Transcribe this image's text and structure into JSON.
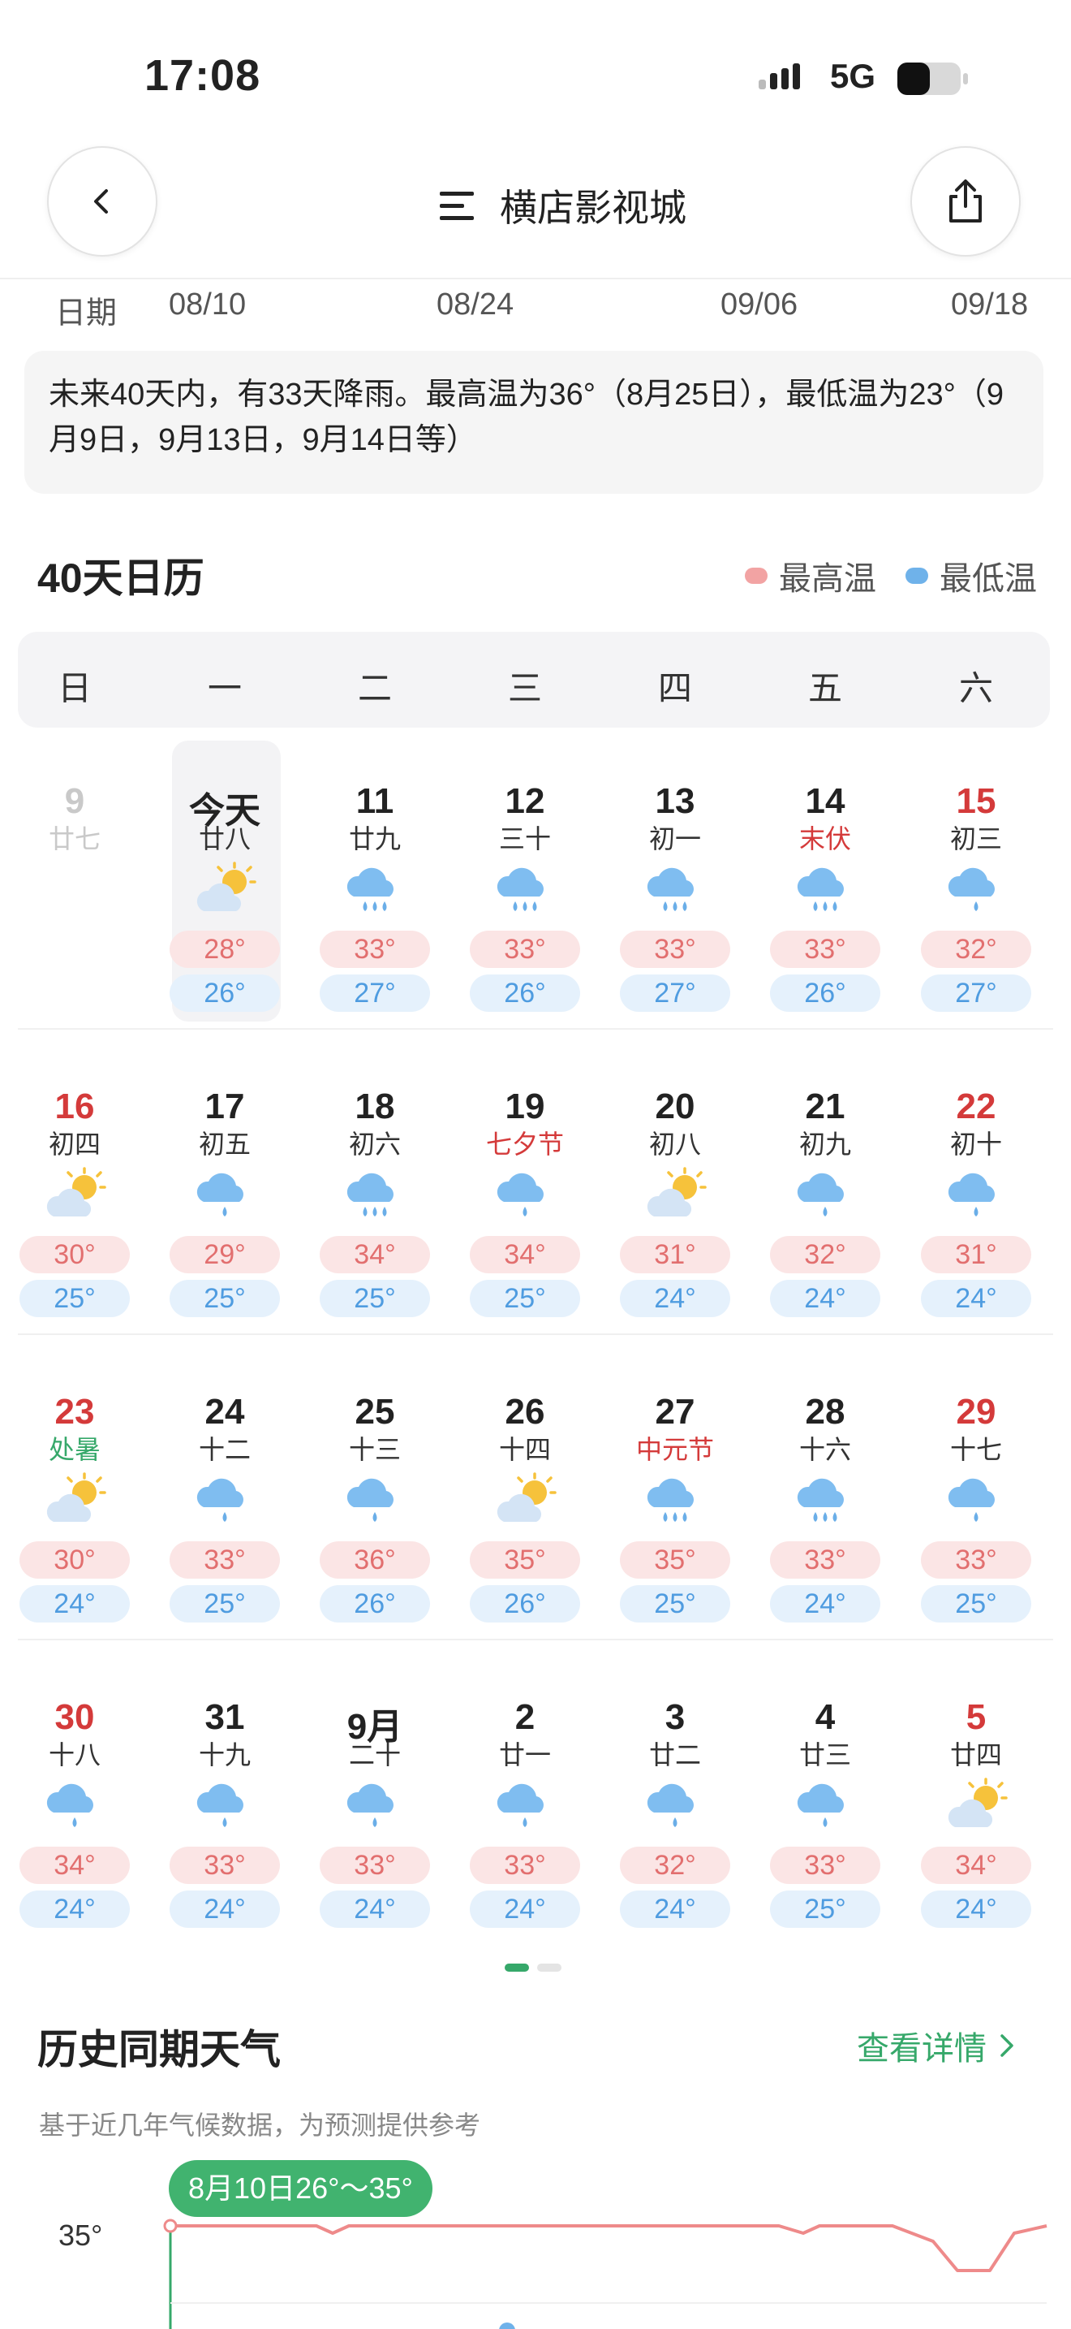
{
  "status": {
    "time": "17:08",
    "network": "5G"
  },
  "header": {
    "title": "横店影视城"
  },
  "axis": {
    "label": "日期",
    "dates": [
      "08/10",
      "08/24",
      "09/06",
      "09/18"
    ]
  },
  "summary": {
    "text": "未来40天内，有33天降雨。最高温为36°（8月25日），最低温为23°（9月9日，9月13日，9月14日等）"
  },
  "calendar": {
    "title": "40天日历",
    "legend": {
      "high": "最高温",
      "low": "最低温",
      "high_color": "#f2a3a3",
      "low_color": "#6fb2ea"
    },
    "weekdays": [
      "日",
      "一",
      "二",
      "三",
      "四",
      "五",
      "六"
    ],
    "rows": [
      [
        {
          "d": "9",
          "l": "廿七",
          "icon": "",
          "hi": "",
          "lo": "",
          "state": "past"
        },
        {
          "d": "今天",
          "l": "廿八",
          "icon": "sun-cloud",
          "hi": "28°",
          "lo": "26°",
          "state": "today"
        },
        {
          "d": "11",
          "l": "廿九",
          "icon": "rain-heavy",
          "hi": "33°",
          "lo": "27°"
        },
        {
          "d": "12",
          "l": "三十",
          "icon": "rain-heavy",
          "hi": "33°",
          "lo": "26°"
        },
        {
          "d": "13",
          "l": "初一",
          "icon": "rain-heavy",
          "hi": "33°",
          "lo": "27°"
        },
        {
          "d": "14",
          "l": "末伏",
          "icon": "rain-heavy",
          "hi": "33°",
          "lo": "26°",
          "lunar": "red"
        },
        {
          "d": "15",
          "l": "初三",
          "icon": "rain-light",
          "hi": "32°",
          "lo": "27°",
          "day": "red"
        }
      ],
      [
        {
          "d": "16",
          "l": "初四",
          "icon": "sun-cloud",
          "hi": "30°",
          "lo": "25°",
          "day": "red"
        },
        {
          "d": "17",
          "l": "初五",
          "icon": "rain-light",
          "hi": "29°",
          "lo": "25°"
        },
        {
          "d": "18",
          "l": "初六",
          "icon": "rain-heavy",
          "hi": "34°",
          "lo": "25°"
        },
        {
          "d": "19",
          "l": "七夕节",
          "icon": "rain-light",
          "hi": "34°",
          "lo": "25°",
          "lunar": "red"
        },
        {
          "d": "20",
          "l": "初八",
          "icon": "sun-cloud",
          "hi": "31°",
          "lo": "24°"
        },
        {
          "d": "21",
          "l": "初九",
          "icon": "rain-light",
          "hi": "32°",
          "lo": "24°"
        },
        {
          "d": "22",
          "l": "初十",
          "icon": "rain-light",
          "hi": "31°",
          "lo": "24°",
          "day": "red"
        }
      ],
      [
        {
          "d": "23",
          "l": "处暑",
          "icon": "sun-cloud",
          "hi": "30°",
          "lo": "24°",
          "day": "red",
          "lunar": "green"
        },
        {
          "d": "24",
          "l": "十二",
          "icon": "rain-light",
          "hi": "33°",
          "lo": "25°"
        },
        {
          "d": "25",
          "l": "十三",
          "icon": "rain-light",
          "hi": "36°",
          "lo": "26°"
        },
        {
          "d": "26",
          "l": "十四",
          "icon": "sun-cloud",
          "hi": "35°",
          "lo": "26°"
        },
        {
          "d": "27",
          "l": "中元节",
          "icon": "rain-heavy",
          "hi": "35°",
          "lo": "25°",
          "lunar": "red"
        },
        {
          "d": "28",
          "l": "十六",
          "icon": "rain-heavy",
          "hi": "33°",
          "lo": "24°"
        },
        {
          "d": "29",
          "l": "十七",
          "icon": "rain-light",
          "hi": "33°",
          "lo": "25°",
          "day": "red"
        }
      ],
      [
        {
          "d": "30",
          "l": "十八",
          "icon": "rain-light",
          "hi": "34°",
          "lo": "24°",
          "day": "red"
        },
        {
          "d": "31",
          "l": "十九",
          "icon": "rain-light",
          "hi": "33°",
          "lo": "24°"
        },
        {
          "d": "9月",
          "l": "二十",
          "icon": "rain-light",
          "hi": "33°",
          "lo": "24°"
        },
        {
          "d": "2",
          "l": "廿一",
          "icon": "rain-light",
          "hi": "33°",
          "lo": "24°"
        },
        {
          "d": "3",
          "l": "廿二",
          "icon": "rain-light",
          "hi": "32°",
          "lo": "24°"
        },
        {
          "d": "4",
          "l": "廿三",
          "icon": "rain-light",
          "hi": "33°",
          "lo": "25°"
        },
        {
          "d": "5",
          "l": "廿四",
          "icon": "sun-cloud",
          "hi": "34°",
          "lo": "24°",
          "day": "red"
        }
      ]
    ]
  },
  "history": {
    "title": "历史同期天气",
    "detail_label": "查看详情",
    "note": "基于近几年气候数据，为预测提供参考",
    "highlight": "8月10日26°～35°",
    "y_label": "35°",
    "line_color": "#ee8a8a"
  }
}
